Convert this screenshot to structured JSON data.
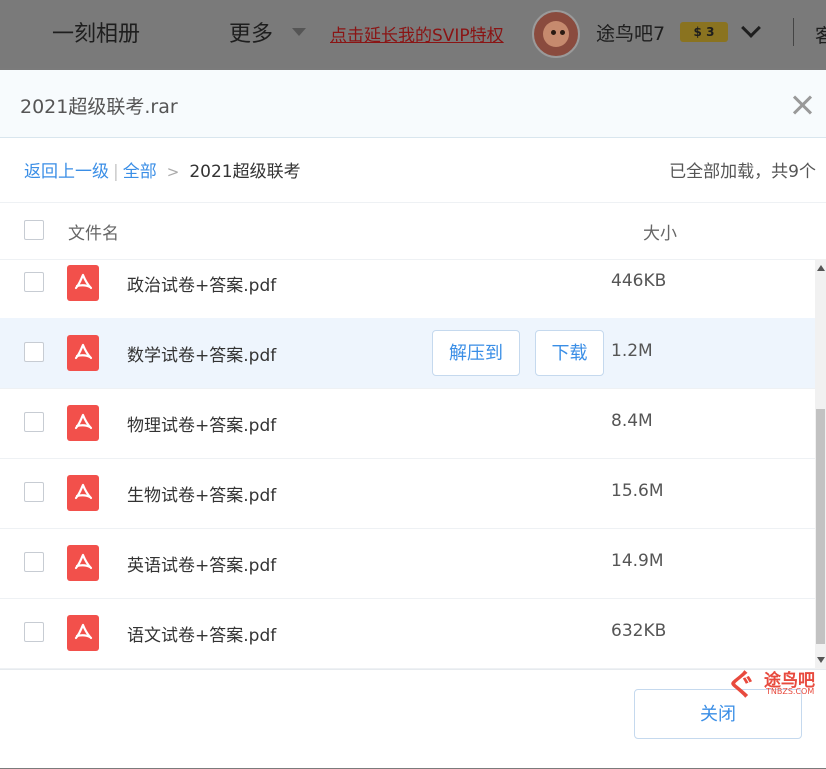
{
  "topbar": {
    "album": "一刻相册",
    "more": "更多",
    "promo": "点击延长我的SVIP特权",
    "username": "途鸟吧7",
    "badge": "$ 3",
    "cut_text": "客"
  },
  "dialog": {
    "title": "2021超级联考.rar",
    "breadcrumb": {
      "back": "返回上一级",
      "sep": "|",
      "all": "全部",
      "gt": ">",
      "current": "2021超级联考"
    },
    "count": "已全部加载，共9个",
    "columns": {
      "name": "文件名",
      "size": "大小"
    },
    "files": [
      {
        "name": "政治试卷+答案.pdf",
        "size": "446KB"
      },
      {
        "name": "数学试卷+答案.pdf",
        "size": "1.2M"
      },
      {
        "name": "物理试卷+答案.pdf",
        "size": "8.4M"
      },
      {
        "name": "生物试卷+答案.pdf",
        "size": "15.6M"
      },
      {
        "name": "英语试卷+答案.pdf",
        "size": "14.9M"
      },
      {
        "name": "语文试卷+答案.pdf",
        "size": "632KB"
      }
    ],
    "row_actions": {
      "extract": "解压到",
      "download": "下载"
    },
    "close_button": "关闭"
  },
  "watermark": {
    "text": "途鸟吧",
    "sub": "TNBZS.COM"
  },
  "colors": {
    "accent": "#3a8ee6",
    "pdf_icon": "#f2504b",
    "hover_row": "#eef5fd",
    "promo": "#8a1414"
  }
}
